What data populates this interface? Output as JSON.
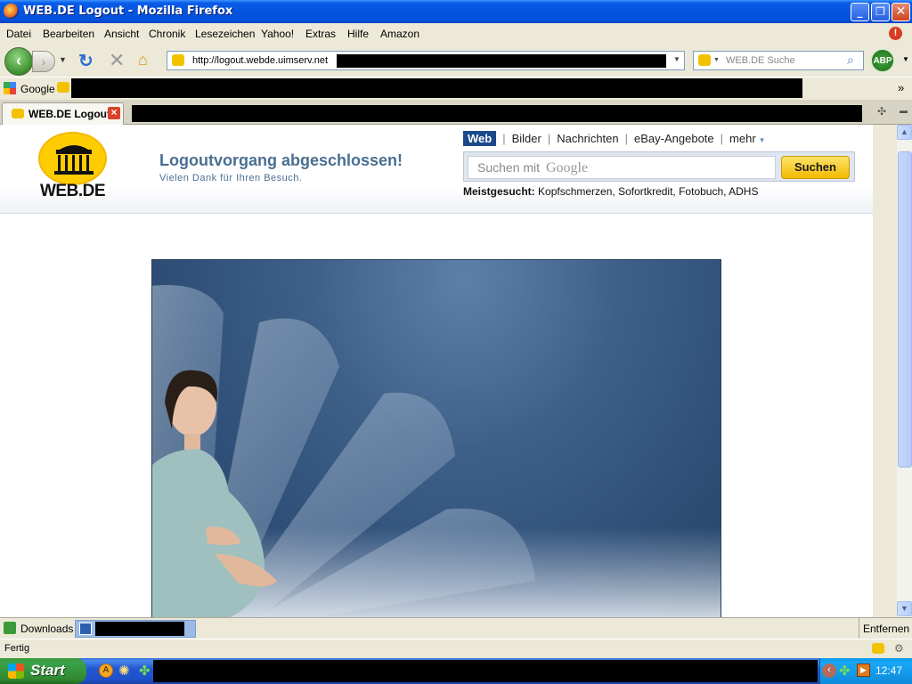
{
  "window": {
    "title": "WEB.DE Logout - Mozilla Firefox"
  },
  "menu": {
    "items": [
      "Datei",
      "Bearbeiten",
      "Ansicht",
      "Chronik",
      "Lesezeichen",
      "Yahoo!",
      "Extras",
      "Hilfe",
      "Amazon"
    ]
  },
  "nav": {
    "url": "http://logout.webde.uimserv.net",
    "search_placeholder": "WEB.DE Suche",
    "abp": "ABP"
  },
  "bookmarks": {
    "google": "Google",
    "overflow": "»"
  },
  "tabs": [
    {
      "label": "WEB.DE Logout",
      "close": "×"
    }
  ],
  "page": {
    "logo": "WEB.DE",
    "title": "Logoutvorgang abgeschlossen!",
    "subtitle": "Vielen Dank für Ihren Besuch.",
    "navtabs": [
      "Web",
      "Bilder",
      "Nachrichten",
      "eBay-Angebote",
      "mehr"
    ],
    "search_placeholder": "Suchen mit",
    "search_brand": "Google",
    "search_button": "Suchen",
    "meist_label": "Meistgesucht:",
    "meist_terms": "Kopfschmerzen, Sofortkredit, Fotobuch, ADHS"
  },
  "downloads": {
    "label": "Downloads",
    "remove": "Entfernen"
  },
  "status": {
    "text": "Fertig"
  },
  "taskbar": {
    "start": "Start",
    "clock": "12:47"
  },
  "colors": {
    "xp_blue": "#0453dc",
    "webde_yellow": "#ffcc00",
    "webde_blue": "#1b4a8a"
  }
}
